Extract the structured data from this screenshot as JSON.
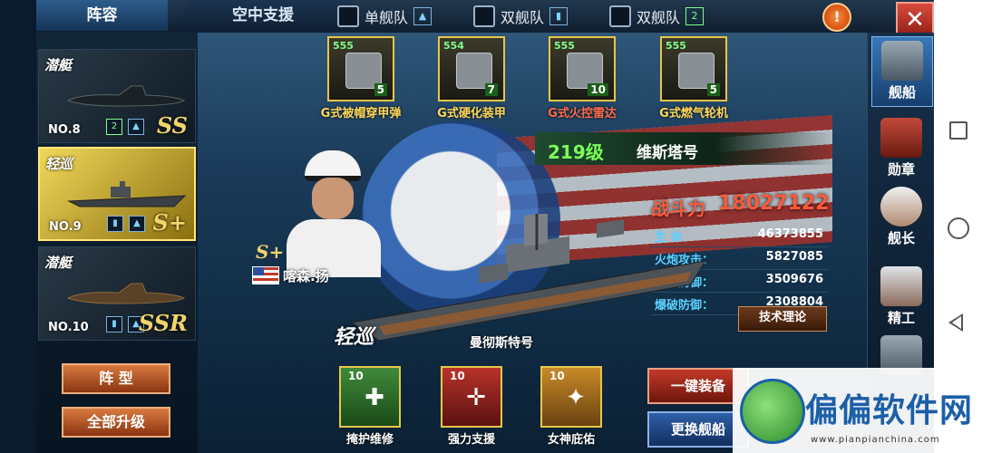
{
  "tabs": {
    "lineup": "阵容",
    "air_support": "空中支援"
  },
  "fleet_options": [
    {
      "label": "单舰队",
      "icon": "single-fleet-icon"
    },
    {
      "label": "双舰队",
      "icon": "double-fleet-icon-blue"
    },
    {
      "label": "双舰队",
      "icon": "double-fleet-icon-green"
    }
  ],
  "info_button": "!",
  "close_button": "✕",
  "ship_list": [
    {
      "type": "潜艇",
      "no": "NO.8",
      "grade": "SS"
    },
    {
      "type": "轻巡",
      "no": "NO.9",
      "grade": "S+"
    },
    {
      "type": "潜艇",
      "no": "NO.10",
      "grade": "SSR"
    }
  ],
  "left_buttons": {
    "formation": "阵  型",
    "upgrade_all": "全部升级"
  },
  "equipment": [
    {
      "name": "G式被帽穿甲弹",
      "level": "555",
      "count": "5"
    },
    {
      "name": "G式硬化装甲",
      "level": "554",
      "count": "7"
    },
    {
      "name": "G式火控雷达",
      "level": "555",
      "count": "10"
    },
    {
      "name": "G式燃气轮机",
      "level": "555",
      "count": "5"
    }
  ],
  "ship": {
    "class": "219级",
    "name": "维斯塔号",
    "tag": "轻巡",
    "subtitle": "曼彻斯特号",
    "power_label": "战斗力",
    "power": "18027122"
  },
  "stats": [
    {
      "label": "生    命",
      "value": "46373855"
    },
    {
      "label": "火炮攻击：",
      "value": "5827085"
    },
    {
      "label": "火炮防御：",
      "value": "3509676"
    },
    {
      "label": "爆破防御：",
      "value": "2308804"
    }
  ],
  "tech_button": "技术理论",
  "captain": {
    "grade": "S+",
    "name": "喀森.扬"
  },
  "skills": [
    {
      "level": "10",
      "name": "掩护维修"
    },
    {
      "level": "10",
      "name": "强力支援"
    },
    {
      "level": "10",
      "name": "女神庇佑"
    }
  ],
  "right_buttons": {
    "equip": "一键装备",
    "change": "更换舰船"
  },
  "right_nav": [
    {
      "label": "舰船"
    },
    {
      "label": "勋章"
    },
    {
      "label": "舰长"
    },
    {
      "label": "精工"
    },
    {
      "label": ""
    }
  ],
  "watermark": {
    "text": "偏偏软件网",
    "url": "www.pianpianchina.com"
  },
  "colors": {
    "accent_gold": "#e6c64a",
    "power_red": "#ff5a3a",
    "stat_blue": "#5ad0ff",
    "class_green": "#7cff5a"
  }
}
